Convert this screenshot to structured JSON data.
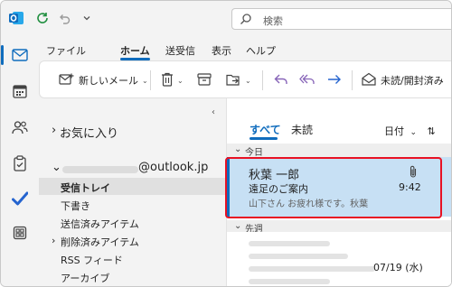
{
  "search": {
    "placeholder": "検索"
  },
  "menu": {
    "tabs": [
      "ファイル",
      "ホーム",
      "送受信",
      "表示",
      "ヘルプ"
    ],
    "active": "ホーム"
  },
  "ribbon": {
    "new_mail": "新しいメール",
    "read_unread": "未読/開封済み"
  },
  "folders": {
    "favorites": "お気に入り",
    "account_suffix": "@outlook.jp",
    "items": [
      "受信トレイ",
      "下書き",
      "送信済みアイテム",
      "削除済みアイテム",
      "RSS フィード",
      "アーカイブ"
    ]
  },
  "list": {
    "tabs": [
      "すべて",
      "未読"
    ],
    "sort": "日付",
    "groups": [
      "今日",
      "先週"
    ],
    "messages": [
      {
        "sender": "秋葉 一郎",
        "subject": "遠足のご案内",
        "preview": "山下さん お疲れ様です。秋葉",
        "time": "9:42",
        "has_attachment": true
      },
      {
        "date": "07/19 (水)"
      }
    ]
  },
  "colors": {
    "accent": "#0f6cbd",
    "selected": "#c7e0f4",
    "highlight": "#e81123"
  },
  "icons": [
    "outlook-logo-icon",
    "sync-icon",
    "undo-icon",
    "search-icon",
    "mail-icon",
    "calendar-icon",
    "people-icon",
    "tasks-icon",
    "todo-icon",
    "apps-icon",
    "new-mail-icon",
    "delete-icon",
    "archive-icon",
    "move-icon",
    "reply-icon",
    "reply-all-icon",
    "forward-icon",
    "envelope-open-icon",
    "attachment-icon"
  ]
}
